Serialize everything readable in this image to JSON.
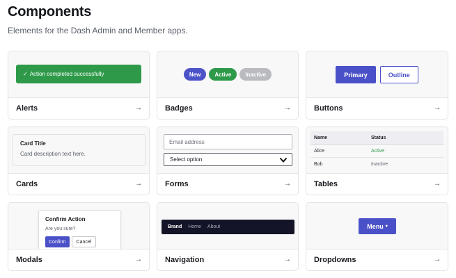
{
  "header": {
    "title": "Components",
    "subtitle": "Elements for the Dash Admin and Member apps."
  },
  "cards": [
    {
      "label": "Alerts",
      "arrow": "→"
    },
    {
      "label": "Badges",
      "arrow": "→"
    },
    {
      "label": "Buttons",
      "arrow": "→"
    },
    {
      "label": "Cards",
      "arrow": "→"
    },
    {
      "label": "Forms",
      "arrow": "→"
    },
    {
      "label": "Tables",
      "arrow": "→"
    },
    {
      "label": "Modals",
      "arrow": "→"
    },
    {
      "label": "Navigation",
      "arrow": "→"
    },
    {
      "label": "Dropdowns",
      "arrow": "→"
    }
  ],
  "alerts_preview": {
    "icon": "✓",
    "text": "Action completed successfully"
  },
  "badges_preview": {
    "new": "New",
    "active": "Active",
    "inactive": "Inactive"
  },
  "buttons_preview": {
    "primary": "Primary",
    "outline": "Outline"
  },
  "cards_preview": {
    "title": "Card Title",
    "description": "Card description text here."
  },
  "forms_preview": {
    "email_placeholder": "Email address",
    "select_value": "Select option"
  },
  "tables_preview": {
    "headers": [
      "Name",
      "Status"
    ],
    "rows": [
      {
        "name": "Alice",
        "status": "Active"
      },
      {
        "name": "Bob",
        "status": "Inactive"
      }
    ]
  },
  "modals_preview": {
    "title": "Confirm Action",
    "body": "Are you sure?",
    "confirm": "Confirm",
    "cancel": "Cancel"
  },
  "navigation_preview": {
    "brand": "Brand",
    "links": [
      "Home",
      "About"
    ]
  },
  "dropdowns_preview": {
    "label": "Menu",
    "caret": "▾"
  },
  "colors": {
    "accent": "#4a51c8",
    "success": "#2e9a49",
    "muted": "#b9bbc0",
    "nav_bg": "#131427"
  }
}
